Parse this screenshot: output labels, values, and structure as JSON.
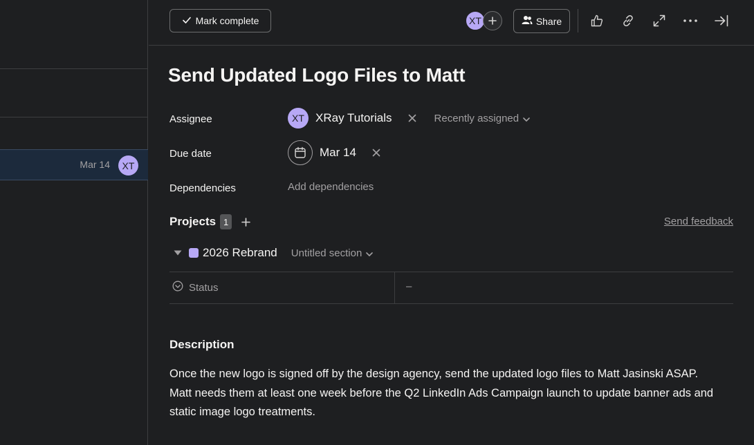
{
  "list_pane": {
    "selected_row": {
      "due": "Mar 14",
      "assignee_initials": "XT"
    }
  },
  "toolbar": {
    "mark_complete_label": "Mark complete",
    "collaborator_initials": "XT",
    "share_label": "Share",
    "icons": [
      "like-icon",
      "link-icon",
      "expand-icon",
      "more-icon",
      "close-pane-icon"
    ]
  },
  "task": {
    "title": "Send Updated Logo Files to Matt",
    "fields": {
      "assignee_label": "Assignee",
      "assignee_initials": "XT",
      "assignee_name": "XRay Tutorials",
      "recently_assigned": "Recently assigned",
      "due_date_label": "Due date",
      "due_date": "Mar 14",
      "dependencies_label": "Dependencies",
      "add_dependencies": "Add dependencies"
    },
    "projects": {
      "label": "Projects",
      "count": "1",
      "send_feedback": "Send feedback",
      "items": [
        {
          "name": "2026 Rebrand",
          "section": "Untitled section",
          "color": "#b7a8f5"
        }
      ],
      "status_label": "Status",
      "status_value": "–"
    },
    "description": {
      "title": "Description",
      "body": "Once the new logo is signed off by the design agency, send the updated logo files to Matt Jasinski ASAP. Matt needs them at least one week before the Q2 LinkedIn Ads Campaign launch to update banner ads and static image logo treatments."
    }
  },
  "colors": {
    "background": "#1e1f21",
    "avatar": "#b7a8f5",
    "selected_row": "#1c2a3c",
    "muted_text": "#a2a0a2"
  }
}
